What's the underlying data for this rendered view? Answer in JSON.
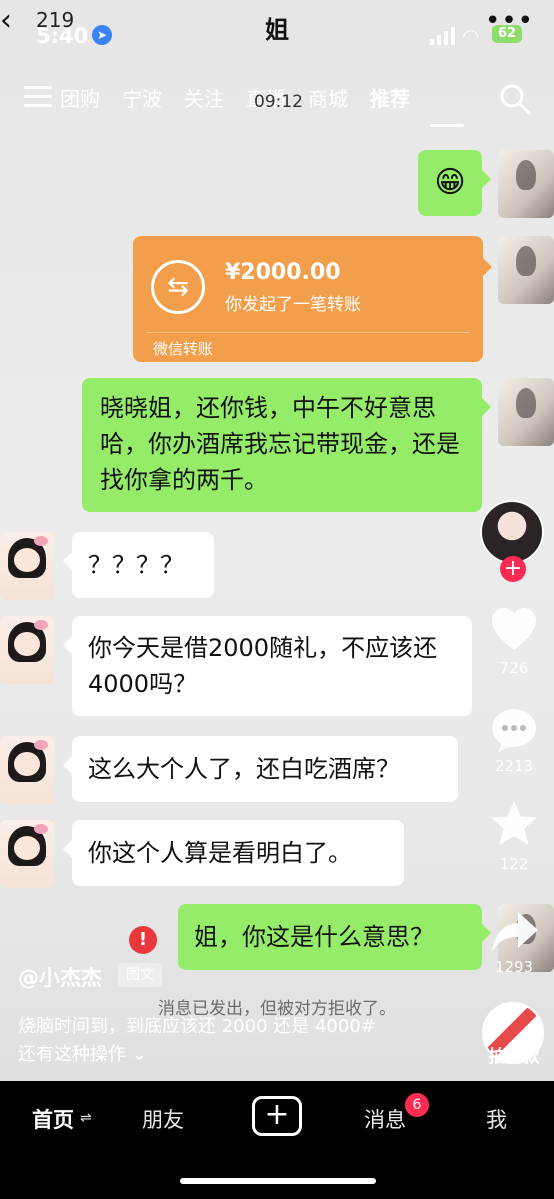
{
  "status_bar": {
    "back_count": "219",
    "time": "5:40",
    "battery": "62"
  },
  "chat": {
    "title": "姐",
    "overlay_time": "09:12",
    "transfer": {
      "amount": "¥2000.00",
      "desc": "你发起了一笔转账",
      "footer": "微信转账"
    },
    "messages": [
      {
        "side": "right",
        "text": "😁"
      },
      {
        "side": "right",
        "text": "晓晓姐，还你钱，中午不好意思哈，你办酒席我忘记带现金，还是找你拿的两千。"
      },
      {
        "side": "left",
        "text": "？？？？"
      },
      {
        "side": "left",
        "text": "你今天是借2000随礼，不应该还4000吗？"
      },
      {
        "side": "left",
        "text": "这么大个人了，还白吃酒席？"
      },
      {
        "side": "left",
        "text": "你这个人算是看明白了。"
      },
      {
        "side": "right",
        "text": "姐，你这是什么意思？"
      }
    ],
    "error_mark": "!",
    "system_notice": "消息已发出，但被对方拒收了。"
  },
  "top_nav": {
    "tabs": [
      "团购",
      "宁波",
      "关注",
      "直播",
      "商城",
      "推荐"
    ],
    "active": "推荐"
  },
  "rail": {
    "likes": "726",
    "comments": "2213",
    "favorites": "122",
    "shares": "1293",
    "remix_label": "拍同款"
  },
  "caption": {
    "author": "@小杰杰",
    "badge": "图文",
    "description": "烧脑时间到，到底应该还 2000 还是 4000#",
    "topic": "还有这种操作 ⌄"
  },
  "bottom_nav": {
    "home": "首页",
    "friends": "朋友",
    "messages": "消息",
    "messages_badge": "6",
    "me": "我"
  },
  "colors": {
    "bubble_green": "#95ec69",
    "transfer_orange": "#f39e4a",
    "accent_red": "#fe2c55"
  }
}
